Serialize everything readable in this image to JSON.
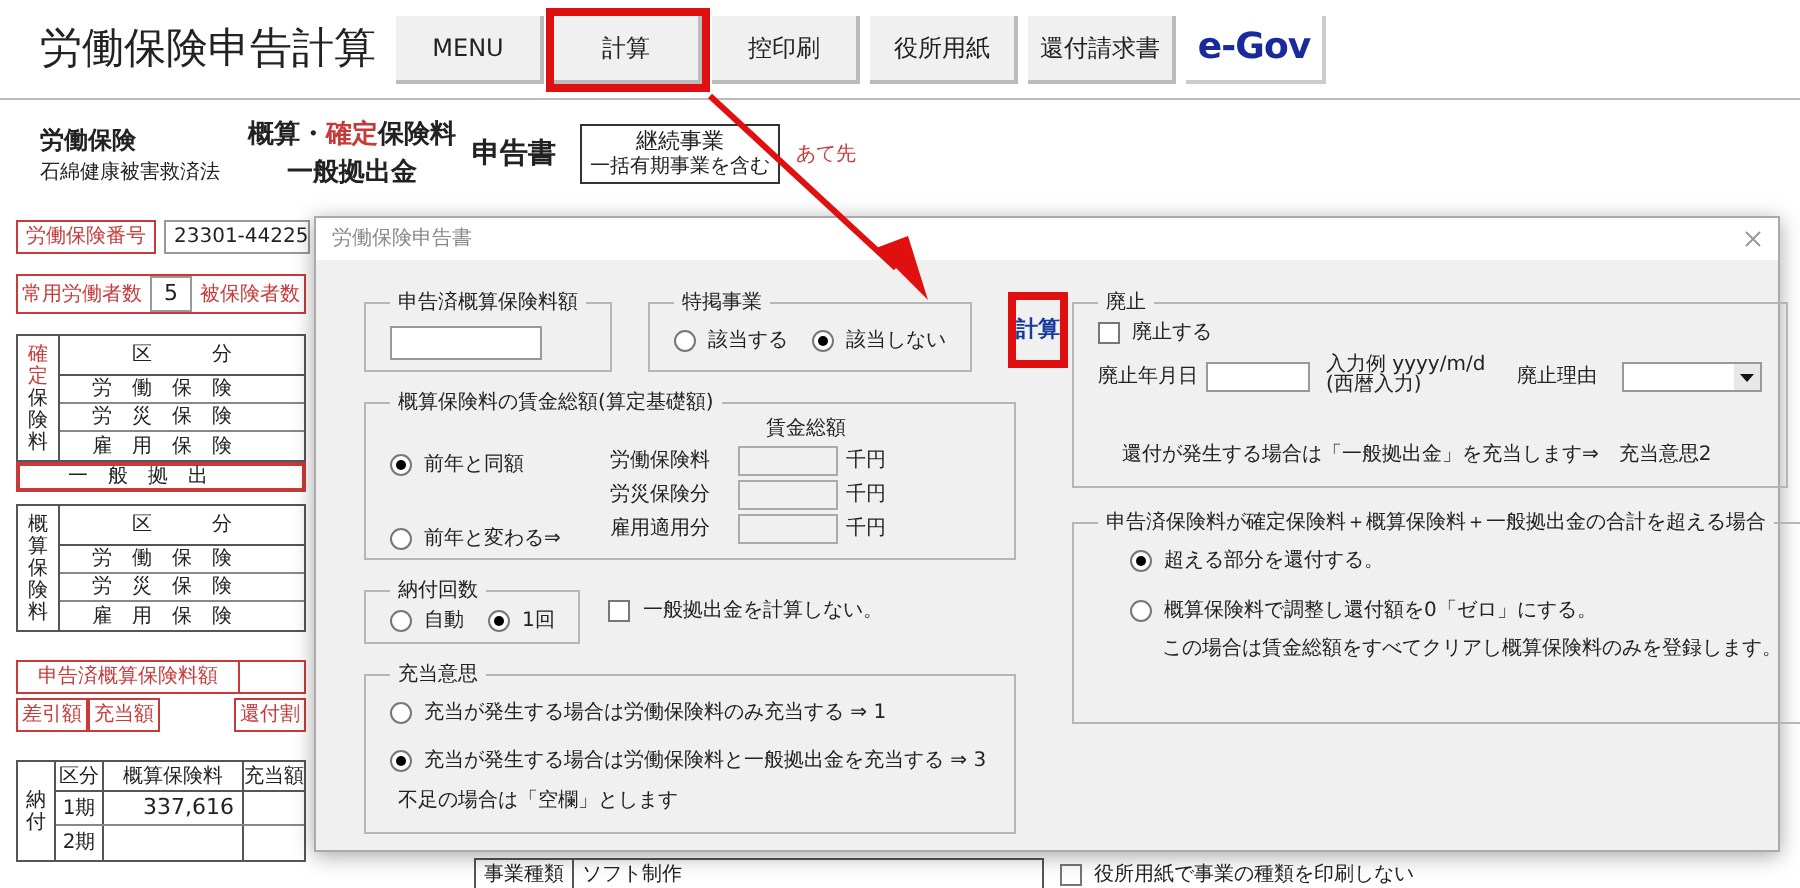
{
  "app": {
    "title": "労働保険申告計算"
  },
  "toolbar": [
    {
      "label": "MENU",
      "highlighted": false
    },
    {
      "label": "計算",
      "highlighted": true
    },
    {
      "label": "控印刷",
      "highlighted": false
    },
    {
      "label": "役所用紙",
      "highlighted": false
    },
    {
      "label": "還付請求書",
      "highlighted": false
    }
  ],
  "logo": {
    "text": "e-Gov"
  },
  "form_header": {
    "law": "労働保険",
    "law_sub": "石綿健康被害救済法",
    "title_line1": [
      {
        "text": "概算・",
        "accent": false
      },
      {
        "text": "確定",
        "accent": true
      },
      {
        "text": "保険料",
        "accent": false
      }
    ],
    "title_line2": "一般拠出金",
    "doc": "申告書",
    "business_box": {
      "main": "継続事業",
      "sub": "一括有期事業を含む"
    },
    "addressee": "あて先"
  },
  "insurance_number": {
    "label": "労働保険番号",
    "value": "23301-44225"
  },
  "workers": {
    "label": "常用労働者数",
    "value": "5",
    "label2": "被保険者数"
  },
  "confirmed_table": {
    "side": [
      {
        "text": "確定",
        "accent": true
      },
      {
        "text": "保険料",
        "accent": false
      }
    ],
    "header": "区　　　分",
    "rows": [
      "労　働　保　険",
      "労　災　保　険",
      "雇　用　保　険"
    ]
  },
  "general_contribution": "一　般　拠　出",
  "estimated_table": {
    "side": [
      {
        "text": "概算保険料",
        "accent": false
      }
    ],
    "header": "区　　　分",
    "rows": [
      "労　働　保　険",
      "労　災　保　険",
      "雇　用　保　険"
    ]
  },
  "declared_label": "申告済概算保険料額",
  "diff_row": [
    "差引額",
    "充当額",
    "還付割"
  ],
  "payment_table": {
    "side": "納付",
    "columns": [
      "区分",
      "概算保険料",
      "充当額"
    ],
    "rows": [
      {
        "term": "1期",
        "amount": "337,616"
      },
      {
        "term": "2期"
      }
    ]
  },
  "business_type": {
    "label": "事業種類",
    "value": "ソフト制作"
  },
  "print_option": {
    "label": "役所用紙で事業の種類を印刷しない",
    "checked": false
  },
  "dialog": {
    "title": "労働保険申告書",
    "declared_amount": {
      "legend": "申告済概算保険料額"
    },
    "special": {
      "legend": "特掲事業",
      "options": [
        {
          "label": "該当する",
          "selected": false
        },
        {
          "label": "該当しない",
          "selected": true
        }
      ]
    },
    "calc_button": {
      "label": "計算",
      "highlighted": true
    },
    "wage": {
      "legend": "概算保険料の賃金総額(算定基礎額)",
      "options": [
        {
          "label": "前年と同額",
          "selected": true
        },
        {
          "label": "前年と変わる⇒",
          "selected": false
        }
      ],
      "column_header": "賃金総額",
      "rows": [
        {
          "label": "労働保険料",
          "unit": "千円"
        },
        {
          "label": "労災保険分",
          "unit": "千円"
        },
        {
          "label": "雇用適用分",
          "unit": "千円"
        }
      ]
    },
    "installments": {
      "legend": "納付回数",
      "options": [
        {
          "label": "自動",
          "selected": false
        },
        {
          "label": "1回",
          "selected": true
        }
      ]
    },
    "skip_general": {
      "label": "一般拠出金を計算しない。",
      "checked": false
    },
    "allocation": {
      "legend": "充当意思",
      "options": [
        {
          "label": "充当が発生する場合は労働保険料のみ充当する ⇒ 1",
          "selected": false
        },
        {
          "label": "充当が発生する場合は労働保険料と一般拠出金を充当する ⇒ 3",
          "selected": true
        }
      ],
      "note": "不足の場合は「空欄」とします"
    },
    "abolition": {
      "legend": "廃止",
      "checkbox": {
        "label": "廃止する",
        "checked": false
      },
      "date_label": "廃止年月日",
      "example": "入力例 yyyy/m/d",
      "example_sub": "(西暦入力)",
      "reason_label": "廃止理由",
      "note": "還付が発生する場合は「一般拠出金」を充当します⇒　充当意思2"
    },
    "excess": {
      "legend": "申告済保険料が確定保険料＋概算保険料＋一般拠出金の合計を超える場合",
      "options": [
        {
          "label": "超える部分を還付する。",
          "selected": true
        },
        {
          "label": "概算保険料で調整し還付額を0「ゼロ」にする。",
          "selected": false,
          "note": "この場合は賃金総額をすべてクリアし概算保険料のみを登録します。"
        }
      ]
    }
  }
}
